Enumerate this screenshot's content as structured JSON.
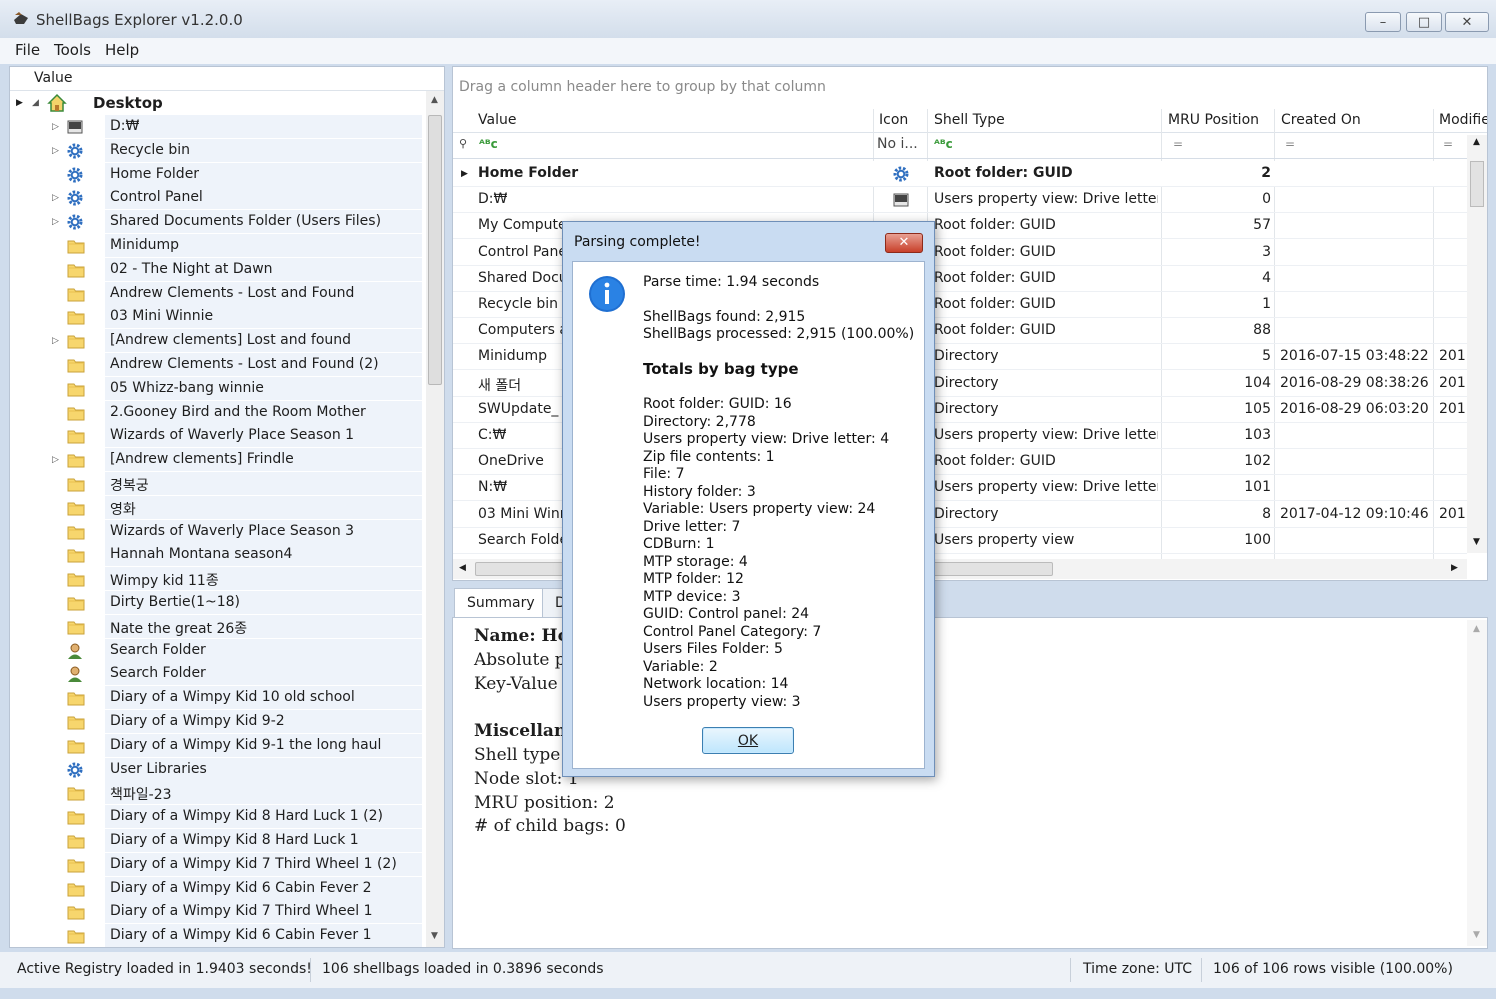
{
  "window": {
    "title": "ShellBags Explorer v1.2.0.0",
    "minimize": "–",
    "maximize": "□",
    "close": "✕"
  },
  "menu": [
    "File",
    "Tools",
    "Help"
  ],
  "tree": {
    "header": "Value",
    "root": "Desktop",
    "items": [
      {
        "label": "D:₩",
        "icon": "drive-icon",
        "expandable": true
      },
      {
        "label": "Recycle bin",
        "icon": "gear-icon",
        "expandable": true
      },
      {
        "label": "Home Folder",
        "icon": "gear-icon",
        "expandable": false
      },
      {
        "label": "Control Panel",
        "icon": "gear-icon",
        "expandable": true
      },
      {
        "label": "Shared Documents Folder (Users Files)",
        "icon": "gear-icon",
        "expandable": true
      },
      {
        "label": "Minidump",
        "icon": "folder-icon",
        "expandable": false
      },
      {
        "label": "02 - The Night at Dawn",
        "icon": "folder-icon",
        "expandable": false
      },
      {
        "label": "Andrew Clements - Lost and Found",
        "icon": "folder-icon",
        "expandable": false
      },
      {
        "label": "03 Mini Winnie",
        "icon": "folder-icon",
        "expandable": false
      },
      {
        "label": "[Andrew clements] Lost and found",
        "icon": "folder-icon",
        "expandable": true
      },
      {
        "label": "Andrew Clements - Lost and Found (2)",
        "icon": "folder-icon",
        "expandable": false
      },
      {
        "label": "05 Whizz-bang winnie",
        "icon": "folder-icon",
        "expandable": false
      },
      {
        "label": "2.Gooney Bird and the Room Mother",
        "icon": "folder-icon",
        "expandable": false
      },
      {
        "label": "Wizards of Waverly Place Season 1",
        "icon": "folder-icon",
        "expandable": false
      },
      {
        "label": "[Andrew clements] Frindle",
        "icon": "folder-icon",
        "expandable": true
      },
      {
        "label": "경복궁",
        "icon": "folder-icon",
        "expandable": false
      },
      {
        "label": "영화",
        "icon": "folder-icon",
        "expandable": false
      },
      {
        "label": "Wizards of Waverly Place Season 3",
        "icon": "folder-icon",
        "expandable": false
      },
      {
        "label": "Hannah Montana season4",
        "icon": "folder-icon",
        "expandable": false
      },
      {
        "label": "Wimpy kid 11종",
        "icon": "folder-icon",
        "expandable": false
      },
      {
        "label": "Dirty Bertie(1~18)",
        "icon": "folder-icon",
        "expandable": false
      },
      {
        "label": "Nate the great 26종",
        "icon": "folder-icon",
        "expandable": false
      },
      {
        "label": "Search Folder",
        "icon": "search-folder-icon",
        "expandable": false
      },
      {
        "label": "Search Folder",
        "icon": "search-folder-icon",
        "expandable": false
      },
      {
        "label": "Diary of a Wimpy Kid 10 old school",
        "icon": "folder-icon",
        "expandable": false
      },
      {
        "label": "Diary of a Wimpy Kid 9-2",
        "icon": "folder-icon",
        "expandable": false
      },
      {
        "label": "Diary of a Wimpy Kid 9-1 the long haul",
        "icon": "folder-icon",
        "expandable": false
      },
      {
        "label": "User Libraries",
        "icon": "gear-icon",
        "expandable": false
      },
      {
        "label": "책파일-23",
        "icon": "folder-icon",
        "expandable": false
      },
      {
        "label": "Diary of a Wimpy Kid 8 Hard Luck 1 (2)",
        "icon": "folder-icon",
        "expandable": false
      },
      {
        "label": "Diary of a Wimpy Kid 8 Hard Luck 1",
        "icon": "folder-icon",
        "expandable": false
      },
      {
        "label": "Diary of a Wimpy Kid 7 Third Wheel 1 (2)",
        "icon": "folder-icon",
        "expandable": false
      },
      {
        "label": "Diary of a Wimpy Kid 6 Cabin Fever 2",
        "icon": "folder-icon",
        "expandable": false
      },
      {
        "label": "Diary of a Wimpy Kid 7 Third Wheel 1",
        "icon": "folder-icon",
        "expandable": false
      },
      {
        "label": "Diary of a Wimpy Kid 6 Cabin Fever 1",
        "icon": "folder-icon",
        "expandable": false
      }
    ]
  },
  "grid": {
    "group_hint": "Drag a column header here to group by that column",
    "columns": [
      "Value",
      "Icon",
      "Shell Type",
      "MRU Position",
      "Created On",
      "Modifie"
    ],
    "filter_icon_filter": "No i...",
    "filter_eq": "=",
    "rows": [
      {
        "value": "Home Folder",
        "icon": "gear-icon",
        "shell_type": "Root folder: GUID",
        "mru": "2",
        "created": "",
        "modified": ""
      },
      {
        "value": "D:₩",
        "icon": "drive-icon",
        "shell_type": "Users property view: Drive letter",
        "mru": "0",
        "created": "",
        "modified": ""
      },
      {
        "value": "My Compute",
        "icon": "",
        "shell_type": "Root folder: GUID",
        "mru": "57",
        "created": "",
        "modified": ""
      },
      {
        "value": "Control Pane",
        "icon": "",
        "shell_type": "Root folder: GUID",
        "mru": "3",
        "created": "",
        "modified": ""
      },
      {
        "value": "Shared Docu",
        "icon": "",
        "shell_type": "Root folder: GUID",
        "mru": "4",
        "created": "",
        "modified": ""
      },
      {
        "value": "Recycle bin",
        "icon": "",
        "shell_type": "Root folder: GUID",
        "mru": "1",
        "created": "",
        "modified": ""
      },
      {
        "value": "Computers a",
        "icon": "",
        "shell_type": "Root folder: GUID",
        "mru": "88",
        "created": "",
        "modified": ""
      },
      {
        "value": "Minidump",
        "icon": "",
        "shell_type": "Directory",
        "mru": "5",
        "created": "2016-07-15 03:48:22",
        "modified": "201"
      },
      {
        "value": "새 폴더",
        "icon": "",
        "shell_type": "Directory",
        "mru": "104",
        "created": "2016-08-29 08:38:26",
        "modified": "201"
      },
      {
        "value": "SWUpdate_",
        "icon": "",
        "shell_type": "Directory",
        "mru": "105",
        "created": "2016-08-29 06:03:20",
        "modified": "201"
      },
      {
        "value": "C:₩",
        "icon": "",
        "shell_type": "Users property view: Drive letter",
        "mru": "103",
        "created": "",
        "modified": ""
      },
      {
        "value": "OneDrive",
        "icon": "",
        "shell_type": "Root folder: GUID",
        "mru": "102",
        "created": "",
        "modified": ""
      },
      {
        "value": "N:₩",
        "icon": "",
        "shell_type": "Users property view: Drive letter",
        "mru": "101",
        "created": "",
        "modified": ""
      },
      {
        "value": "03 Mini Winn",
        "icon": "",
        "shell_type": "Directory",
        "mru": "8",
        "created": "2017-04-12 09:10:46",
        "modified": "201"
      },
      {
        "value": "Search Folde",
        "icon": "",
        "shell_type": "Users property view",
        "mru": "100",
        "created": "",
        "modified": ""
      }
    ]
  },
  "details": {
    "tabs": [
      "Summary",
      "D"
    ],
    "lines": [
      {
        "text": "Name: Ho",
        "bold": true
      },
      {
        "text": "Absolute p",
        "bold": false
      },
      {
        "text": "Key-Value",
        "bold": false
      },
      {
        "text": "",
        "bold": false
      },
      {
        "text": "Miscellane",
        "bold": true
      },
      {
        "text": "Shell type:",
        "bold": false
      },
      {
        "text": "Node slot: 1",
        "bold": false
      },
      {
        "text": "MRU position: 2",
        "bold": false
      },
      {
        "text": "# of child bags: 0",
        "bold": false
      }
    ]
  },
  "status": {
    "registry": "Active Registry loaded in 1.9403 seconds!",
    "shellbags": "106 shellbags loaded in 0.3896 seconds",
    "timezone": "Time zone: UTC",
    "rows_visible": "106 of 106 rows visible (100.00%)"
  },
  "dialog": {
    "title": "Parsing complete!",
    "close": "✕",
    "parse_time": "Parse time: 1.94 seconds",
    "found": "ShellBags found: 2,915",
    "processed": "ShellBags processed: 2,915 (100.00%)",
    "totals_heading": "Totals by bag type",
    "totals": [
      "Root folder: GUID: 16",
      "Directory: 2,778",
      "Users property view: Drive letter: 4",
      "Zip file contents: 1",
      "File: 7",
      "History folder: 3",
      "Variable: Users property view: 24",
      "Drive letter: 7",
      "CDBurn: 1",
      "MTP storage: 4",
      "MTP folder: 12",
      "MTP device: 3",
      "GUID: Control panel: 24",
      "Control Panel Category: 7",
      "Users Files Folder: 5",
      "Variable: 2",
      "Network location: 14",
      "Users property view: 3"
    ],
    "ok": "OK"
  },
  "colors": {
    "accent": "#3a78c6",
    "dialog_frame": "#c9dcf2",
    "row_tint": "#eef3fa",
    "close_red": "#c8402a"
  }
}
